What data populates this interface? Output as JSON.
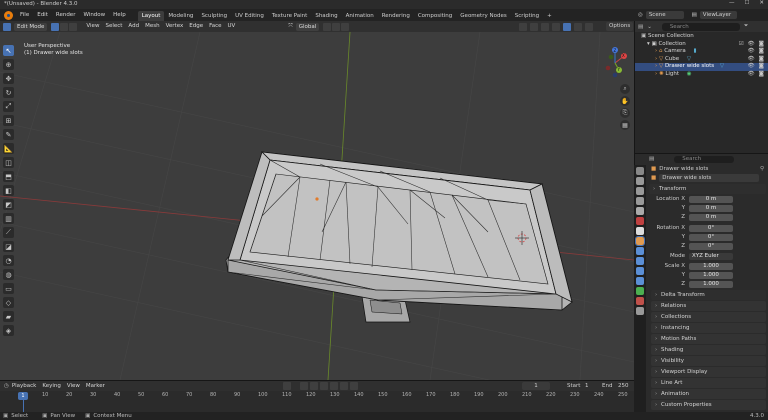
{
  "window": {
    "title": "*(Unsaved) - Blender 4.3.0",
    "min": "—",
    "max": "☐",
    "close": "✕"
  },
  "menu": [
    "File",
    "Edit",
    "Render",
    "Window",
    "Help"
  ],
  "workspaces": [
    "Layout",
    "Modeling",
    "Sculpting",
    "UV Editing",
    "Texture Paint",
    "Shading",
    "Animation",
    "Rendering",
    "Compositing",
    "Geometry Nodes",
    "Scripting",
    "+"
  ],
  "workspace_active": "Layout",
  "scene": {
    "label": "Scene",
    "viewlayer": "ViewLayer"
  },
  "viewport_header": {
    "mode": "Edit Mode",
    "menus": [
      "View",
      "Select",
      "Add",
      "Mesh",
      "Vertex",
      "Edge",
      "Face",
      "UV"
    ],
    "transform_orientation": "Global",
    "options": "Options"
  },
  "viewport_info": {
    "line1": "User Perspective",
    "line2": "(1) Drawer wide slots"
  },
  "nav_gizmo": {
    "x": "X",
    "y": "Y",
    "z": "Z"
  },
  "outliner": {
    "search_placeholder": "Search",
    "rows": [
      {
        "label": "Scene Collection",
        "indent": 0
      },
      {
        "label": "Collection",
        "indent": 1
      },
      {
        "label": "Camera",
        "indent": 2,
        "icon": "camera-icon"
      },
      {
        "label": "Cube",
        "indent": 2,
        "icon": "mesh-icon"
      },
      {
        "label": "Drawer wide slots",
        "indent": 2,
        "icon": "mesh-icon",
        "selected": true
      },
      {
        "label": "Light",
        "indent": 2,
        "icon": "light-icon"
      }
    ]
  },
  "properties": {
    "search_placeholder": "Search",
    "object_name": "Drawer wide slots",
    "object_name2": "Drawer wide slots",
    "transform_title": "Transform",
    "location": {
      "label": "Location X",
      "x": "0 m",
      "y": "0 m",
      "z": "0 m",
      "ylabel": "Y",
      "zlabel": "Z"
    },
    "rotation": {
      "label": "Rotation X",
      "x": "0°",
      "y": "0°",
      "z": "0°",
      "ylabel": "Y",
      "zlabel": "Z"
    },
    "mode": {
      "label": "Mode",
      "value": "XYZ Euler"
    },
    "scale": {
      "label": "Scale X",
      "x": "1.000",
      "y": "1.000",
      "z": "1.000",
      "ylabel": "Y",
      "zlabel": "Z"
    },
    "sections": [
      "Delta Transform",
      "Relations",
      "Collections",
      "Instancing",
      "Motion Paths",
      "Shading",
      "Visibility",
      "Viewport Display",
      "Line Art",
      "Animation",
      "Custom Properties"
    ]
  },
  "timeline": {
    "menus": [
      "Playback",
      "Keying",
      "View",
      "Marker"
    ],
    "current_frame": "1",
    "start_label": "Start",
    "start": "1",
    "end_label": "End",
    "end": "250",
    "ruler": [
      "1",
      "10",
      "20",
      "30",
      "40",
      "50",
      "60",
      "70",
      "80",
      "90",
      "100",
      "110",
      "120",
      "130",
      "140",
      "150",
      "160",
      "170",
      "180",
      "190",
      "200",
      "210",
      "220",
      "230",
      "240",
      "250"
    ],
    "cursor_frame": "1"
  },
  "status": {
    "select": "Select",
    "pan": "Pan View",
    "context": "Context Menu",
    "version": "4.3.0"
  },
  "colors": {
    "accent": "#4772b3",
    "viewport_bg": "#3d3d3d",
    "mesh_face": "#b8b8b8",
    "mesh_edge": "#111111"
  }
}
